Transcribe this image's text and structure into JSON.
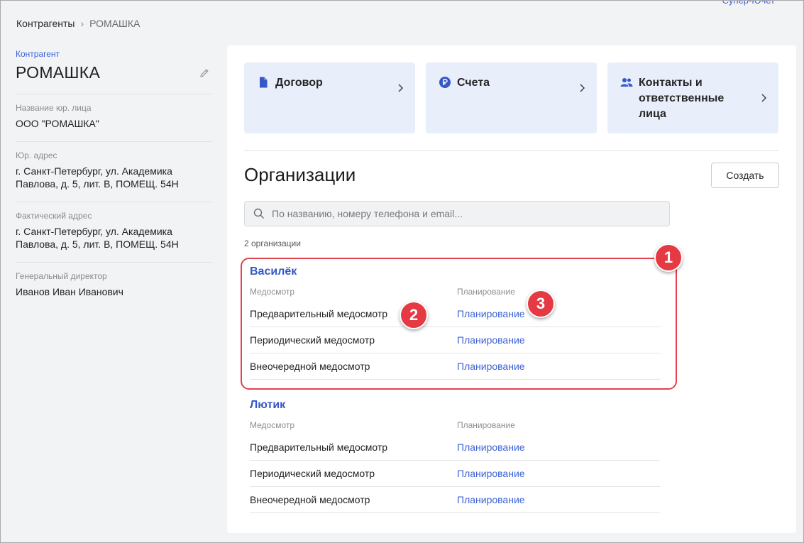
{
  "top_cut_text": "Супер-Ючет",
  "breadcrumb": {
    "root": "Контрагенты",
    "separator": "›",
    "current": "РОМАШКА"
  },
  "sidebar": {
    "tag": "Контрагент",
    "title": "РОМАШКА",
    "fields": [
      {
        "label": "Название юр. лица",
        "value": "ООО \"РОМАШКА\""
      },
      {
        "label": "Юр. адрес",
        "value": "г. Санкт-Петербург, ул. Академика Павлова, д. 5, лит. В, ПОМЕЩ. 54Н"
      },
      {
        "label": "Фактический адрес",
        "value": "г. Санкт-Петербург, ул. Академика Павлова, д. 5, лит. В, ПОМЕЩ. 54Н"
      },
      {
        "label": "Генеральный директор",
        "value": "Иванов Иван Иванович"
      }
    ]
  },
  "cards": [
    {
      "label": "Договор",
      "icon": "document-icon"
    },
    {
      "label": "Счета",
      "icon": "ruble-icon"
    },
    {
      "label": "Контакты и ответственные лица",
      "icon": "users-icon"
    }
  ],
  "organizations_section": {
    "title": "Организации",
    "create_label": "Создать",
    "search_placeholder": "По названию, номеру телефона и email...",
    "count_text": "2 организации"
  },
  "organizations": [
    {
      "name": "Василёк",
      "col_exam": "Медосмотр",
      "col_plan": "Планирование",
      "rows": [
        {
          "exam": "Предварительный медосмотр",
          "plan": "Планирование"
        },
        {
          "exam": "Периодический медосмотр",
          "plan": "Планирование"
        },
        {
          "exam": "Внеочередной медосмотр",
          "plan": "Планирование"
        }
      ]
    },
    {
      "name": "Лютик",
      "col_exam": "Медосмотр",
      "col_plan": "Планирование",
      "rows": [
        {
          "exam": "Предварительный медосмотр",
          "plan": "Планирование"
        },
        {
          "exam": "Периодический медосмотр",
          "plan": "Планирование"
        },
        {
          "exam": "Внеочередной медосмотр",
          "plan": "Планирование"
        }
      ]
    }
  ],
  "annotations": {
    "marker_1": "1",
    "marker_2": "2",
    "marker_3": "3",
    "color": "#e53a44"
  },
  "colors": {
    "accent": "#3d63d6",
    "card_bg": "#e9eefb",
    "page_bg": "#f2f3f5"
  }
}
